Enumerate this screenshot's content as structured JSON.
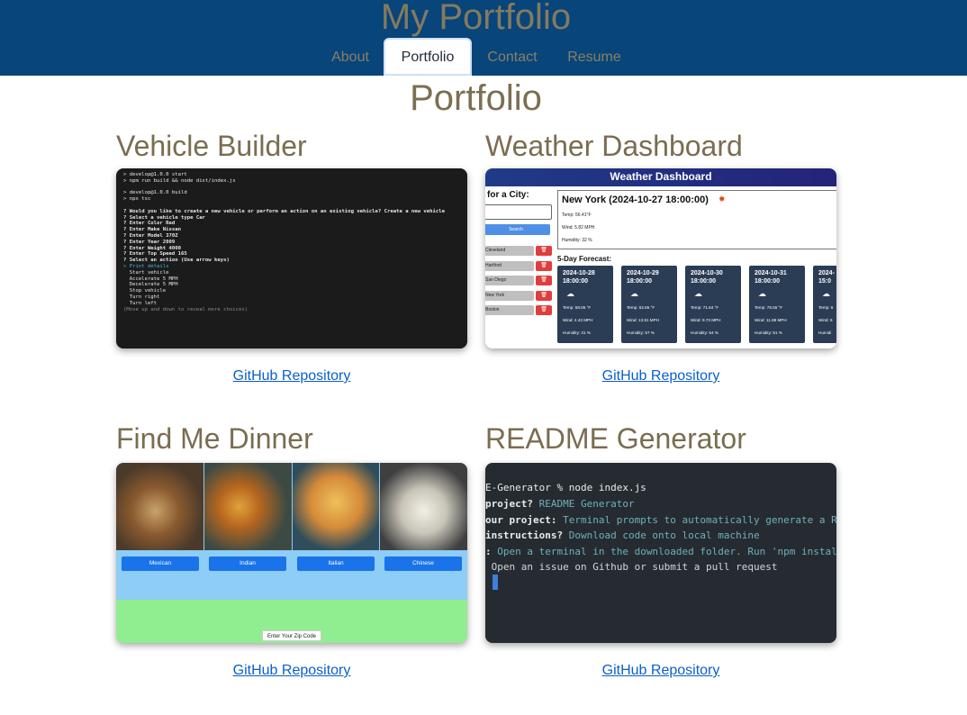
{
  "header": {
    "site_title": "My Portfolio",
    "nav": [
      "About",
      "Portfolio",
      "Contact",
      "Resume"
    ],
    "active_nav": "Portfolio"
  },
  "page_title": "Portfolio",
  "projects": [
    {
      "title": "Vehicle Builder",
      "link_label": "GitHub Repository",
      "terminal_lines": [
        "> develop@1.0.0 start",
        "> npm run build && node dist/index.js",
        "",
        "> develop@1.0.0 build",
        "> npx tsc",
        "",
        "? Would you like to create a new vehicle or perform an action on an existing vehicle? Create a new vehicle",
        "? Select a vehicle type Car",
        "? Enter Color Red",
        "? Enter Make Nissan",
        "? Enter Model 370Z",
        "? Enter Year 2009",
        "? Enter Weight 4000",
        "? Enter Top Speed 165",
        "? Select an action (Use arrow keys)",
        "> Print details",
        "  Start vehicle",
        "  Accelerate 5 MPH",
        "  Decelerate 5 MPH",
        "  Stop vehicle",
        "  Turn right",
        "  Turn left",
        "(Move up and down to reveal more choices)"
      ]
    },
    {
      "title": "Weather Dashboard",
      "link_label": "GitHub Repository",
      "app_title": "Weather Dashboard",
      "city_label": "for a City:",
      "search_label": "Search",
      "history": [
        "Cleveland",
        "Hartford",
        "San Diego",
        "New York",
        "Boston"
      ],
      "today": {
        "title": "New York (2024-10-27 18:00:00)",
        "temp": "Temp: 56.41°F",
        "wind": "Wind: 5.82 MPH",
        "humidity": "Humidity: 32 %"
      },
      "forecast_label": "5-Day Forecast:",
      "forecast": [
        {
          "date": "2024-10-28\n18:00:00",
          "temp": "Temp: 58.05 °F",
          "wind": "Wind: 4.43 MPH",
          "humidity": "Humidity: 31 %"
        },
        {
          "date": "2024-10-29\n18:00:00",
          "temp": "Temp: 62.65 °F",
          "wind": "Wind: 13.91 MPH",
          "humidity": "Humidity: 57 %"
        },
        {
          "date": "2024-10-30\n18:00:00",
          "temp": "Temp: 71.84 °F",
          "wind": "Wind: 9.73 MPH",
          "humidity": "Humidity: 54 %"
        },
        {
          "date": "2024-10-31\n18:00:00",
          "temp": "Temp: 76.55 °F",
          "wind": "Wind: 11.88 MPH",
          "humidity": "Humidity: 51 %"
        },
        {
          "date": "2024-\n15:0",
          "temp": "Temp: 6",
          "wind": "Wind: 6",
          "humidity": "Humidi"
        }
      ]
    },
    {
      "title": "Find Me Dinner",
      "link_label": "GitHub Repository",
      "cuisines": [
        "Mexican",
        "Indian",
        "Italian",
        "Chinese"
      ],
      "zip_label": "Enter Your Zip Code"
    },
    {
      "title": "README Generator",
      "link_label": "GitHub Repository",
      "terminal_lines": [
        {
          "label": "E-Generator % node index.js",
          "value": ""
        },
        {
          "label": "project? ",
          "value": "README Generator"
        },
        {
          "label": "our project: ",
          "value": "Terminal prompts to automatically generate a RE"
        },
        {
          "label": "instructions? ",
          "value": "Download code onto local machine"
        },
        {
          "label": ": ",
          "value": "Open a terminal in the downloaded folder. Run 'npm install"
        },
        {
          "label": " ",
          "value": "Open an issue on Github or submit a pull request"
        }
      ]
    }
  ],
  "colors": {
    "header_bg": "#07457a",
    "heading": "#7b6f52",
    "link": "#0a5fd0"
  }
}
